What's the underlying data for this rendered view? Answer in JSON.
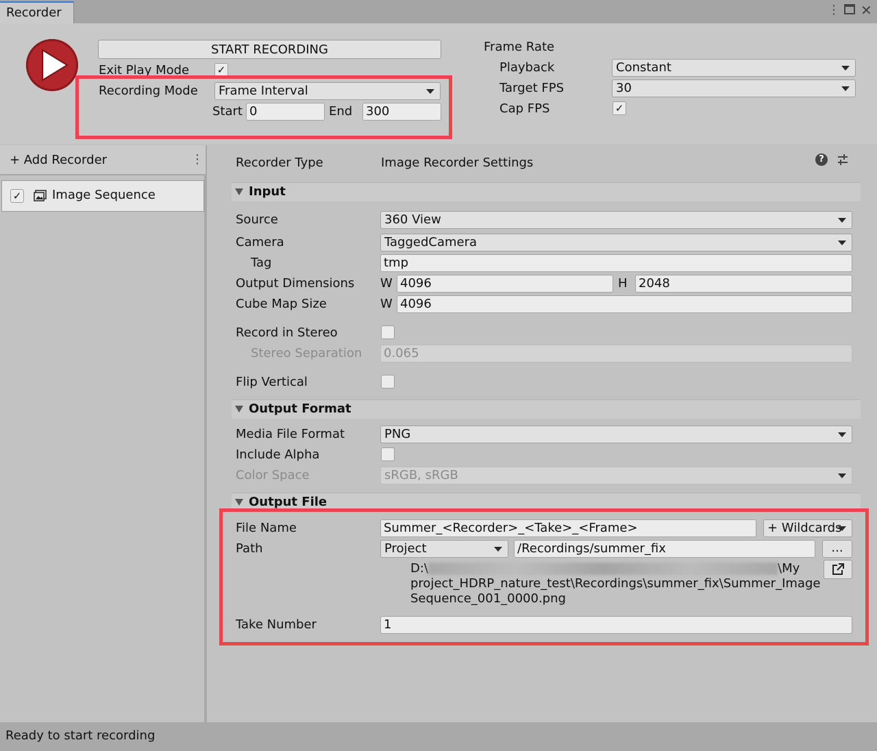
{
  "window": {
    "tab_title": "Recorder",
    "menu_icon": "kebab-menu-icon",
    "maximize_icon": "maximize-icon",
    "close_icon": "close-icon"
  },
  "top": {
    "start_button": "START RECORDING",
    "exit_play_mode_label": "Exit Play Mode",
    "exit_play_mode_checked": true,
    "recording_mode_label": "Recording Mode",
    "recording_mode_value": "Frame Interval",
    "start_label": "Start",
    "start_value": "0",
    "end_label": "End",
    "end_value": "300",
    "frame_rate_label": "Frame Rate",
    "playback_label": "Playback",
    "playback_value": "Constant",
    "target_fps_label": "Target FPS",
    "target_fps_value": "30",
    "cap_fps_label": "Cap FPS",
    "cap_fps_checked": true
  },
  "left": {
    "add_recorder": "+ Add Recorder",
    "items": [
      {
        "label": "Image Sequence",
        "enabled": true
      }
    ]
  },
  "recorder": {
    "type_label": "Recorder Type",
    "type_value": "Image Recorder Settings",
    "input": {
      "header": "Input",
      "source_label": "Source",
      "source_value": "360 View",
      "camera_label": "Camera",
      "camera_value": "TaggedCamera",
      "tag_label": "Tag",
      "tag_value": "tmp",
      "output_dim_label": "Output Dimensions",
      "w_label": "W",
      "w_value": "4096",
      "h_label": "H",
      "h_value": "2048",
      "cube_map_label": "Cube Map Size",
      "cube_w_label": "W",
      "cube_w_value": "4096",
      "stereo_label": "Record in Stereo",
      "stereo_sep_label": "Stereo Separation",
      "stereo_sep_value": "0.065",
      "flip_label": "Flip Vertical"
    },
    "output_format": {
      "header": "Output Format",
      "media_label": "Media File Format",
      "media_value": "PNG",
      "alpha_label": "Include Alpha",
      "color_space_label": "Color Space",
      "color_space_value": "sRGB, sRGB"
    },
    "output_file": {
      "header": "Output File",
      "file_name_label": "File Name",
      "file_name_value": "Summer_<Recorder>_<Take>_<Frame>",
      "wildcards": "+ Wildcards",
      "path_label": "Path",
      "path_root": "Project",
      "path_value": "/Recordings/summer_fix",
      "browse": "...",
      "resolved_line1_start": "D:\\",
      "resolved_line1_end": "\\My",
      "resolved_line2": "project_HDRP_nature_test\\Recordings\\summer_fix\\Summer_Image",
      "resolved_line3": "Sequence_001_0000.png",
      "take_label": "Take Number",
      "take_value": "1"
    }
  },
  "status": "Ready to start recording",
  "colors": {
    "highlight": "#f0424a",
    "record": "#b3262b"
  }
}
